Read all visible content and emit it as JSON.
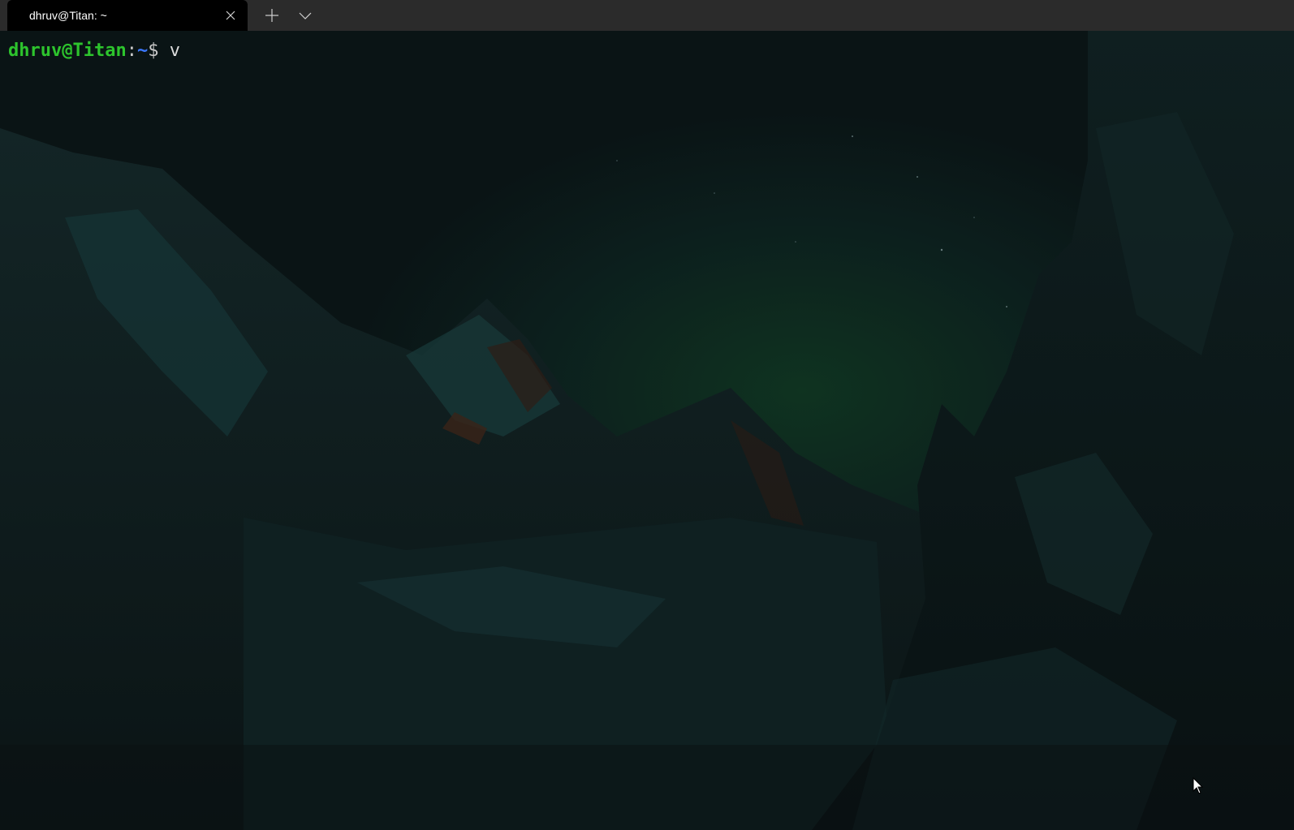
{
  "window": {
    "tab_title": "dhruv@Titan: ~",
    "icons": {
      "close": "close-icon",
      "new_tab": "plus-icon",
      "dropdown": "chevron-down-icon",
      "mouse": "mouse-pointer-icon"
    }
  },
  "terminal": {
    "prompt": {
      "user_host": "dhruv@Titan",
      "separator": ":",
      "path": "~",
      "dollar": "$ ",
      "command": "v"
    },
    "colors": {
      "user_host": "#2dc42d",
      "path": "#3b78ff",
      "text": "#dcdcdc",
      "background": "#0b1213"
    }
  }
}
